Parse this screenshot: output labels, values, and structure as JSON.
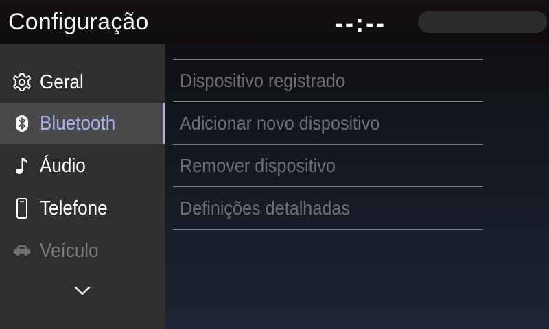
{
  "header": {
    "title": "Configuração",
    "clock": "--:--"
  },
  "sidebar": {
    "items": [
      {
        "label": "Geral",
        "icon": "gear-icon"
      },
      {
        "label": "Bluetooth",
        "icon": "bluetooth-icon",
        "selected": true
      },
      {
        "label": "Áudio",
        "icon": "music-note-icon"
      },
      {
        "label": "Telefone",
        "icon": "phone-icon"
      },
      {
        "label": "Veículo",
        "icon": "car-icon",
        "disabled": true
      }
    ],
    "more_icon": "chevron-down-icon"
  },
  "main": {
    "menu": [
      {
        "label": "Dispositivo registrado"
      },
      {
        "label": "Adicionar novo dispositivo"
      },
      {
        "label": "Remover dispositivo"
      },
      {
        "label": "Definições detalhadas"
      }
    ]
  },
  "colors": {
    "accent": "#a8b2ef",
    "sidebar_bg": "#2f2f2f",
    "selected_bg": "#4a4a4a",
    "disabled_text": "#7b7b7b",
    "menu_text": "#6d6f74"
  }
}
